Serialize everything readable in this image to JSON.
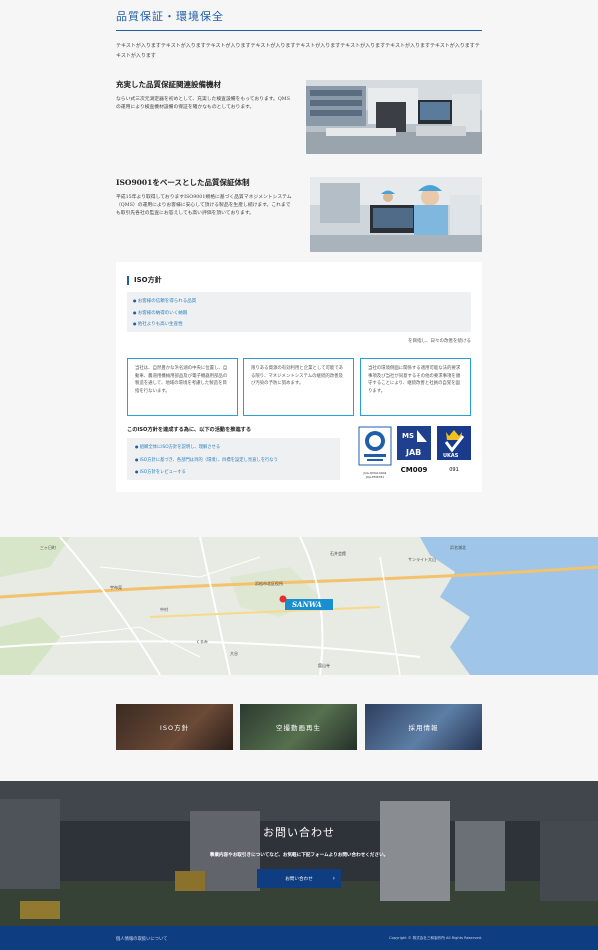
{
  "section": {
    "title": "品質保証・環境保全",
    "intro": "テキストが入りますテキストが入りますテキストが入りますテキストが入りますテキストが入りますテキストが入りますテキストが入りますテキストが入りますテキストが入ります"
  },
  "features": [
    {
      "heading": "充実した品質保証関連設備機材",
      "body": "ならい式三次元測定器を初めとして、充実した検査設備をもっております。QMSの運用により検査機材設備の保証を確かなものとしております。"
    },
    {
      "heading": "ISO9001をベースとした品質保証体制",
      "body": "平成15年より取得しておりますISO9001規格に基づく品質マネジメントシステム（QMS）の運用によりお客様に安心して頂ける製品を生産し続けます。これまでも取引先各社の監査にお答えしても高い評価を頂いております。"
    }
  ],
  "iso": {
    "title": "ISO方針",
    "policies": [
      "お客様の信頼を得られる品質",
      "お客様の納得のいく納期",
      "他社よりも高い生産性"
    ],
    "aim": "を目指し、日々の改善を続ける",
    "cards": [
      "当社は、自然豊かな浜名湖の中央に位置し、自動車、農道用機械用部品及び電子機器用部品の製造を通して、地域の環境を考慮した製造を目指を行ないます。",
      "限りある資源の有効利用と企業として可能である限り、マネジメントシステムの継続的改善及び汚染の予防に努めます。",
      "当社の環境側面に関係する適用可能な法的要求事項及び当社が同意するその他の要求事項を順守することにより、継続改善と社員の自覚を図ります。"
    ],
    "activities_title": "このISO方針を達成する為に、以下の活動を推進する",
    "activities": [
      "組織全体にISO方針を説明し、理解させる",
      "ISO方針に基づき、各部門は目的（環境）、目標を設定し見直しを行なう",
      "ISO方針をレビューする"
    ],
    "logos": [
      {
        "caption": "JQA-QMA10004\nJQA-EM6781",
        "label": "JQA"
      },
      {
        "caption": "CM009",
        "label": "JAB"
      },
      {
        "caption": "091",
        "label": "UKAS"
      }
    ]
  },
  "map": {
    "marker": "SANWA",
    "labels": [
      "石井会館",
      "浜名湖北",
      "サンライト大山",
      "浜松市北区役所",
      "三ヶ日町",
      "中村",
      "大谷",
      "舘山寺",
      "宇布見",
      "くるみ"
    ]
  },
  "banners": [
    {
      "label": "ISO方針"
    },
    {
      "label": "空撮動画再生"
    },
    {
      "label": "採用情報"
    }
  ],
  "contact": {
    "title": "お問い合わせ",
    "text": "事業内容やお取引きについてなど、お気軽に下記フォームよりお問い合わせください。",
    "button": "お問い合わせ",
    "arrow": "›"
  },
  "footer": {
    "privacy": "個人情報の取扱いについて",
    "copyright": "Copyright © 株式会社三和製作所 All Rights Reserved."
  },
  "colors": {
    "accent": "#1f5fa8",
    "link": "#2a7fc0",
    "footer": "#0f3d82"
  }
}
